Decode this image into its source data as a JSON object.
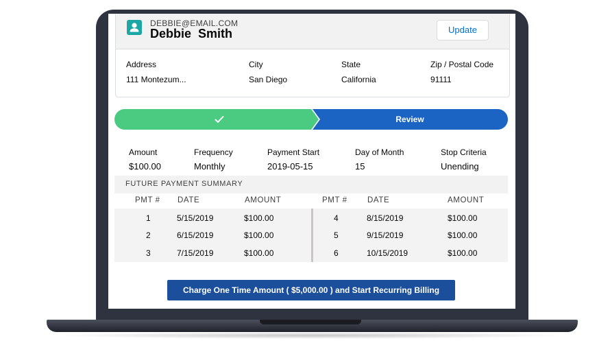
{
  "contact": {
    "email": "DEBBIE@EMAIL.COM",
    "name": "Debbie  Smith",
    "update_label": "Update",
    "address_label": "Address",
    "address_value": "111 Montezum...",
    "city_label": "City",
    "city_value": "San Diego",
    "state_label": "State",
    "state_value": "California",
    "zip_label": "Zip / Postal Code",
    "zip_value": "91111"
  },
  "path": {
    "steps": [
      {
        "label": "",
        "status": "complete"
      },
      {
        "label": "Review",
        "status": "current"
      }
    ]
  },
  "summary": {
    "amount_label": "Amount",
    "amount_value": "$100.00",
    "frequency_label": "Frequency",
    "frequency_value": "Monthly",
    "start_label": "Payment Start",
    "start_value": "2019-05-15",
    "day_label": "Day of Month",
    "day_value": "15",
    "stop_label": "Stop Criteria",
    "stop_value": "Unending"
  },
  "future": {
    "title": "FUTURE PAYMENT SUMMARY",
    "headers": [
      "PMT #",
      "DATE",
      "AMOUNT"
    ],
    "left_rows": [
      [
        "1",
        "5/15/2019",
        "$100.00"
      ],
      [
        "2",
        "6/15/2019",
        "$100.00"
      ],
      [
        "3",
        "7/15/2019",
        "$100.00"
      ]
    ],
    "right_rows": [
      [
        "4",
        "8/15/2019",
        "$100.00"
      ],
      [
        "5",
        "9/15/2019",
        "$100.00"
      ],
      [
        "6",
        "10/15/2019",
        "$100.00"
      ]
    ]
  },
  "charge_button": "Charge One Time Amount ( $5,000.00 ) and Start Recurring Billing",
  "colors": {
    "complete": "#4bca81",
    "current": "#1b64c3",
    "avatar": "#1ca7a6",
    "button": "#1b4f9c"
  },
  "icons": {
    "avatar": "contact-avatar-icon",
    "complete_step": "check-icon"
  }
}
